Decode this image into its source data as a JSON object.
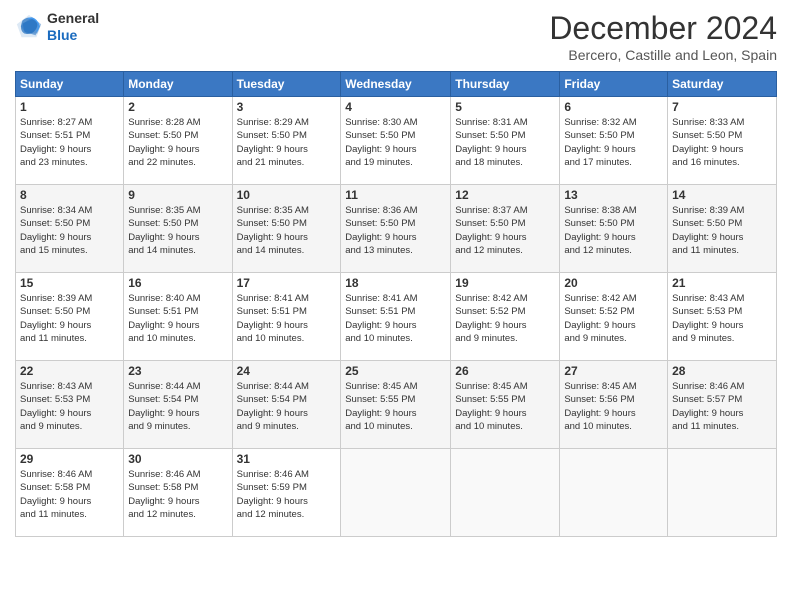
{
  "logo": {
    "line1": "General",
    "line2": "Blue"
  },
  "header": {
    "month": "December 2024",
    "location": "Bercero, Castille and Leon, Spain"
  },
  "weekdays": [
    "Sunday",
    "Monday",
    "Tuesday",
    "Wednesday",
    "Thursday",
    "Friday",
    "Saturday"
  ],
  "weeks": [
    [
      {
        "day": "1",
        "info": "Sunrise: 8:27 AM\nSunset: 5:51 PM\nDaylight: 9 hours\nand 23 minutes."
      },
      {
        "day": "2",
        "info": "Sunrise: 8:28 AM\nSunset: 5:50 PM\nDaylight: 9 hours\nand 22 minutes."
      },
      {
        "day": "3",
        "info": "Sunrise: 8:29 AM\nSunset: 5:50 PM\nDaylight: 9 hours\nand 21 minutes."
      },
      {
        "day": "4",
        "info": "Sunrise: 8:30 AM\nSunset: 5:50 PM\nDaylight: 9 hours\nand 19 minutes."
      },
      {
        "day": "5",
        "info": "Sunrise: 8:31 AM\nSunset: 5:50 PM\nDaylight: 9 hours\nand 18 minutes."
      },
      {
        "day": "6",
        "info": "Sunrise: 8:32 AM\nSunset: 5:50 PM\nDaylight: 9 hours\nand 17 minutes."
      },
      {
        "day": "7",
        "info": "Sunrise: 8:33 AM\nSunset: 5:50 PM\nDaylight: 9 hours\nand 16 minutes."
      }
    ],
    [
      {
        "day": "8",
        "info": "Sunrise: 8:34 AM\nSunset: 5:50 PM\nDaylight: 9 hours\nand 15 minutes."
      },
      {
        "day": "9",
        "info": "Sunrise: 8:35 AM\nSunset: 5:50 PM\nDaylight: 9 hours\nand 14 minutes."
      },
      {
        "day": "10",
        "info": "Sunrise: 8:35 AM\nSunset: 5:50 PM\nDaylight: 9 hours\nand 14 minutes."
      },
      {
        "day": "11",
        "info": "Sunrise: 8:36 AM\nSunset: 5:50 PM\nDaylight: 9 hours\nand 13 minutes."
      },
      {
        "day": "12",
        "info": "Sunrise: 8:37 AM\nSunset: 5:50 PM\nDaylight: 9 hours\nand 12 minutes."
      },
      {
        "day": "13",
        "info": "Sunrise: 8:38 AM\nSunset: 5:50 PM\nDaylight: 9 hours\nand 12 minutes."
      },
      {
        "day": "14",
        "info": "Sunrise: 8:39 AM\nSunset: 5:50 PM\nDaylight: 9 hours\nand 11 minutes."
      }
    ],
    [
      {
        "day": "15",
        "info": "Sunrise: 8:39 AM\nSunset: 5:50 PM\nDaylight: 9 hours\nand 11 minutes."
      },
      {
        "day": "16",
        "info": "Sunrise: 8:40 AM\nSunset: 5:51 PM\nDaylight: 9 hours\nand 10 minutes."
      },
      {
        "day": "17",
        "info": "Sunrise: 8:41 AM\nSunset: 5:51 PM\nDaylight: 9 hours\nand 10 minutes."
      },
      {
        "day": "18",
        "info": "Sunrise: 8:41 AM\nSunset: 5:51 PM\nDaylight: 9 hours\nand 10 minutes."
      },
      {
        "day": "19",
        "info": "Sunrise: 8:42 AM\nSunset: 5:52 PM\nDaylight: 9 hours\nand 9 minutes."
      },
      {
        "day": "20",
        "info": "Sunrise: 8:42 AM\nSunset: 5:52 PM\nDaylight: 9 hours\nand 9 minutes."
      },
      {
        "day": "21",
        "info": "Sunrise: 8:43 AM\nSunset: 5:53 PM\nDaylight: 9 hours\nand 9 minutes."
      }
    ],
    [
      {
        "day": "22",
        "info": "Sunrise: 8:43 AM\nSunset: 5:53 PM\nDaylight: 9 hours\nand 9 minutes."
      },
      {
        "day": "23",
        "info": "Sunrise: 8:44 AM\nSunset: 5:54 PM\nDaylight: 9 hours\nand 9 minutes."
      },
      {
        "day": "24",
        "info": "Sunrise: 8:44 AM\nSunset: 5:54 PM\nDaylight: 9 hours\nand 9 minutes."
      },
      {
        "day": "25",
        "info": "Sunrise: 8:45 AM\nSunset: 5:55 PM\nDaylight: 9 hours\nand 10 minutes."
      },
      {
        "day": "26",
        "info": "Sunrise: 8:45 AM\nSunset: 5:55 PM\nDaylight: 9 hours\nand 10 minutes."
      },
      {
        "day": "27",
        "info": "Sunrise: 8:45 AM\nSunset: 5:56 PM\nDaylight: 9 hours\nand 10 minutes."
      },
      {
        "day": "28",
        "info": "Sunrise: 8:46 AM\nSunset: 5:57 PM\nDaylight: 9 hours\nand 11 minutes."
      }
    ],
    [
      {
        "day": "29",
        "info": "Sunrise: 8:46 AM\nSunset: 5:58 PM\nDaylight: 9 hours\nand 11 minutes."
      },
      {
        "day": "30",
        "info": "Sunrise: 8:46 AM\nSunset: 5:58 PM\nDaylight: 9 hours\nand 12 minutes."
      },
      {
        "day": "31",
        "info": "Sunrise: 8:46 AM\nSunset: 5:59 PM\nDaylight: 9 hours\nand 12 minutes."
      },
      null,
      null,
      null,
      null
    ]
  ]
}
